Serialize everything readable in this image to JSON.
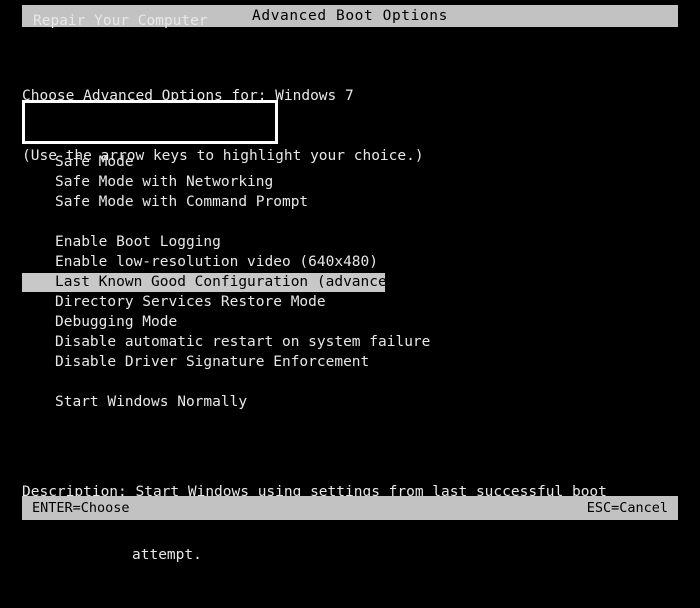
{
  "window": {
    "title": "Advanced Boot Options"
  },
  "intro": {
    "line1": "Choose Advanced Options for: Windows 7",
    "line2": "(Use the arrow keys to highlight your choice.)"
  },
  "repair": {
    "label": "Repair Your Computer",
    "focused": true
  },
  "menu": {
    "items": [
      {
        "label": "Safe Mode",
        "selected": false,
        "spacer_before": false
      },
      {
        "label": "Safe Mode with Networking",
        "selected": false,
        "spacer_before": false
      },
      {
        "label": "Safe Mode with Command Prompt",
        "selected": false,
        "spacer_before": false
      },
      {
        "label": "Enable Boot Logging",
        "selected": false,
        "spacer_before": true
      },
      {
        "label": "Enable low-resolution video (640x480)",
        "selected": false,
        "spacer_before": false
      },
      {
        "label": "Last Known Good Configuration (advanced)",
        "selected": true,
        "spacer_before": false
      },
      {
        "label": "Directory Services Restore Mode",
        "selected": false,
        "spacer_before": false
      },
      {
        "label": "Debugging Mode",
        "selected": false,
        "spacer_before": false
      },
      {
        "label": "Disable automatic restart on system failure",
        "selected": false,
        "spacer_before": false
      },
      {
        "label": "Disable Driver Signature Enforcement",
        "selected": false,
        "spacer_before": false
      },
      {
        "label": "Start Windows Normally",
        "selected": false,
        "spacer_before": true
      }
    ]
  },
  "description": {
    "line1": "Description: Start Windows using settings from last successful boot",
    "line2": "attempt."
  },
  "footer": {
    "enter_label": "ENTER=Choose",
    "esc_label": "ESC=Cancel"
  },
  "colors": {
    "background": "#000000",
    "foreground": "#e8e8e8",
    "bar_background": "#c2c2c2",
    "bar_foreground": "#000000",
    "highlight_background": "#c8c8c8",
    "highlight_foreground": "#000000",
    "focus_border": "#ffffff"
  }
}
